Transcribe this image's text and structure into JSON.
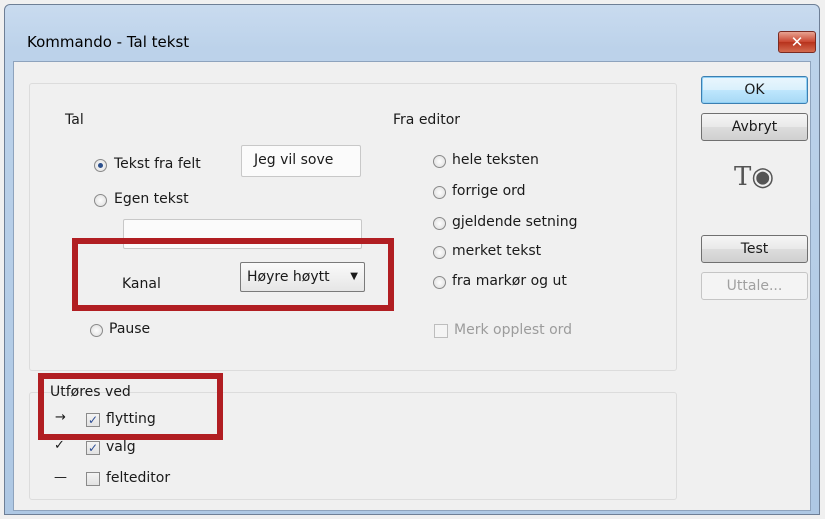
{
  "window": {
    "title": "Kommando - Tal tekst",
    "close_glyph": "✕"
  },
  "tal": {
    "heading": "Tal",
    "options": [
      {
        "label": "Tekst fra felt",
        "checked": true
      },
      {
        "label": "Egen tekst",
        "checked": false
      },
      {
        "label": "Pause",
        "checked": false
      }
    ],
    "field_value": "Jeg vil sove",
    "own_text_value": "",
    "kanal_label": "Kanal",
    "kanal_value": "Høyre høytt",
    "kanal_arrow": "▼"
  },
  "fra_editor": {
    "heading": "Fra editor",
    "options": [
      {
        "label": "hele teksten"
      },
      {
        "label": "forrige ord"
      },
      {
        "label": "gjeldende setning"
      },
      {
        "label": "merket tekst"
      },
      {
        "label": "fra markør og ut"
      }
    ],
    "merk_label": "Merk opplest ord"
  },
  "utfores": {
    "heading": "Utføres ved",
    "items": [
      {
        "mark": "→",
        "label": "flytting",
        "checked": true,
        "check_glyph": "✓"
      },
      {
        "mark": "✓",
        "label": "valg",
        "checked": true,
        "check_glyph": "✓"
      },
      {
        "mark": "—",
        "label": "felteditor",
        "checked": false,
        "check_glyph": ""
      }
    ]
  },
  "buttons": {
    "ok": "OK",
    "cancel": "Avbryt",
    "test": "Test",
    "pronounce": "Uttale..."
  },
  "logo_text": "T◉",
  "colors": {
    "highlight": "#b11e22",
    "title_bar": "#bcd2ea",
    "close_button": "#c9452f"
  }
}
